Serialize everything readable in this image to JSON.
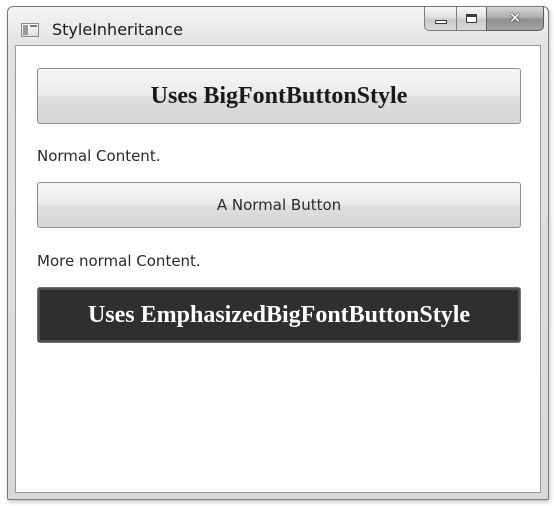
{
  "window": {
    "title": "StyleInheritance"
  },
  "content": {
    "big_button_label": "Uses BigFontButtonStyle",
    "normal_text_1": "Normal Content.",
    "normal_button_label": "A Normal Button",
    "normal_text_2": "More normal Content.",
    "emphasized_button_label": "Uses EmphasizedBigFontButtonStyle"
  },
  "icons": {
    "app": "window-app-icon",
    "minimize": "minimize-icon",
    "maximize": "maximize-icon",
    "close": "close-icon"
  },
  "colors": {
    "emphasized_button_background": "#2f2f2f",
    "emphasized_button_text": "#ffffff"
  }
}
